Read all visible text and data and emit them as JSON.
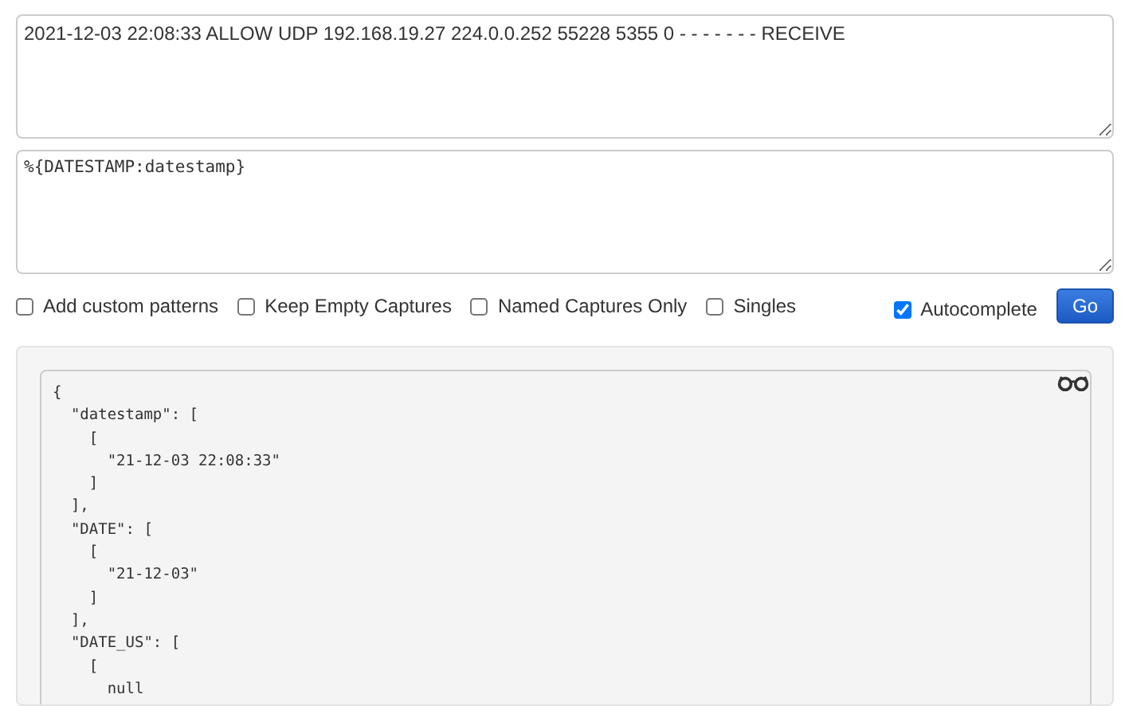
{
  "log_input": {
    "value": "2021-12-03 22:08:33 ALLOW UDP 192.168.19.27 224.0.0.252 55228 5355 0 - - - - - - - RECEIVE"
  },
  "pattern_input": {
    "value": "%{DATESTAMP:datestamp}"
  },
  "options": [
    {
      "label": "Add custom patterns",
      "checked": false
    },
    {
      "label": "Keep Empty Captures",
      "checked": false
    },
    {
      "label": "Named Captures Only",
      "checked": false
    },
    {
      "label": "Singles",
      "checked": false
    }
  ],
  "autocomplete": {
    "label": "Autocomplete",
    "checked": true
  },
  "go_button": "Go",
  "output_lines": [
    "{",
    "  \"datestamp\": [",
    "    [",
    "      \"21-12-03 22:08:33\"",
    "    ]",
    "  ],",
    "  \"DATE\": [",
    "    [",
    "      \"21-12-03\"",
    "    ]",
    "  ],",
    "  \"DATE_US\": [",
    "    [",
    "      null"
  ]
}
